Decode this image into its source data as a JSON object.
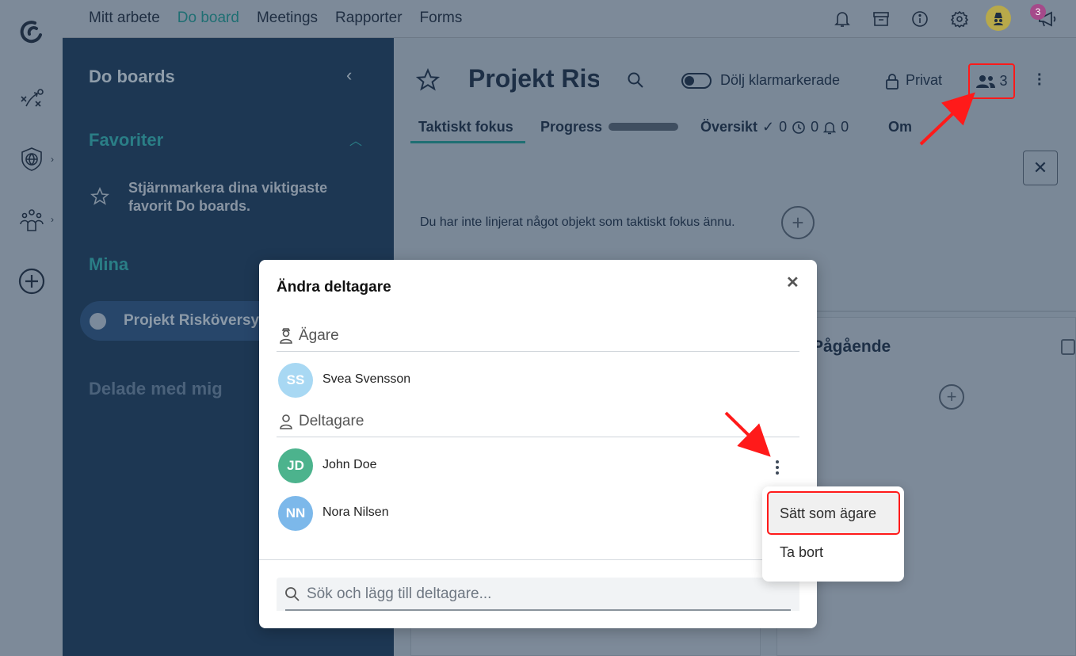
{
  "top_nav": {
    "items": [
      "Mitt arbete",
      "Do board",
      "Meetings",
      "Rapporter",
      "Forms"
    ],
    "active": "Do board",
    "notification_count": "3"
  },
  "sidebar": {
    "title": "Do boards",
    "favorites_heading": "Favoriter",
    "favorites_hint": "Stjärnmarkera dina viktigaste favorit Do boards.",
    "mine_heading": "Mina",
    "mine_item": "Projekt Risköversyn",
    "shared_heading": "Delade med mig"
  },
  "board": {
    "title": "Projekt Riskö",
    "hide_done_label": "Dölj klarmarkerade",
    "privacy_label": "Privat",
    "member_count": "3",
    "tabs": {
      "focus": "Taktiskt fokus",
      "progress": "Progress",
      "overview": "Översikt",
      "done_count": "0",
      "time_count": "0",
      "alert_count": "0",
      "about": "Om"
    },
    "focus_empty_text": "Du har inte linjerat något objekt som taktiskt fokus ännu.",
    "column_heading": "Pågående"
  },
  "modal": {
    "title": "Ändra deltagare",
    "owner_heading": "Ägare",
    "owners": [
      {
        "initials": "SS",
        "name": "Svea Svensson",
        "color": "#a8d8f3"
      }
    ],
    "participant_heading": "Deltagare",
    "participants": [
      {
        "initials": "JD",
        "name": "John Doe",
        "color": "#4cb38d"
      },
      {
        "initials": "NN",
        "name": "Nora Nilsen",
        "color": "#7cb8ea"
      }
    ],
    "search_placeholder": "Sök och lägg till deltagare..."
  },
  "menu": {
    "set_owner": "Sätt som ägare",
    "remove": "Ta bort"
  },
  "colors": {
    "accent": "#1f6f73",
    "annotation": "#ff1a1a"
  }
}
